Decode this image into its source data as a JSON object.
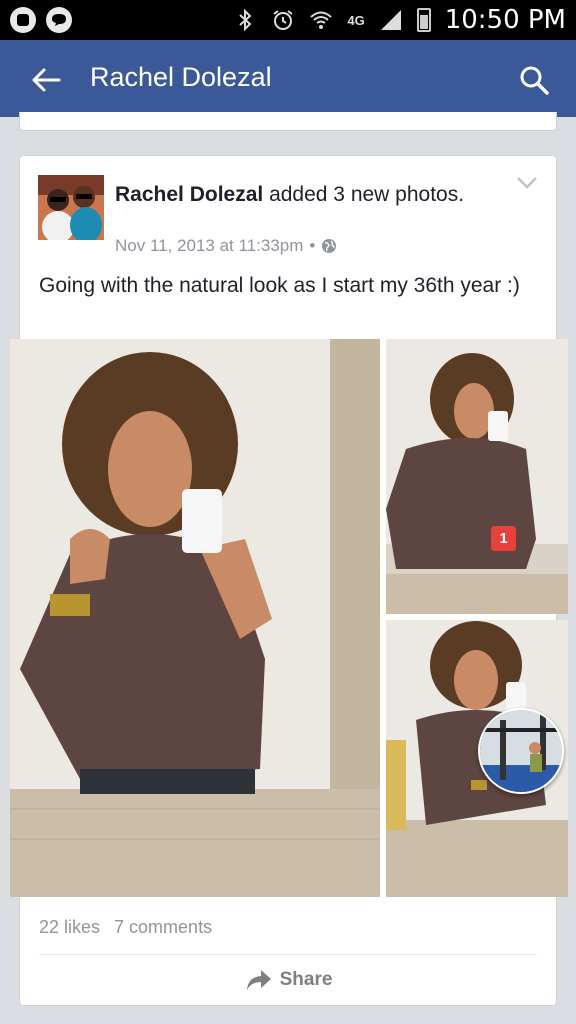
{
  "status_bar": {
    "time": "10:50 PM",
    "network": "4G",
    "icons": [
      "messenger-icon",
      "chat-icon",
      "bluetooth-icon",
      "alarm-icon",
      "wifi-icon",
      "signal-icon",
      "battery-icon"
    ]
  },
  "header": {
    "title": "Rachel Dolezal",
    "back_icon": "arrow-left-icon",
    "search_icon": "search-icon",
    "background": "#3b5998"
  },
  "post": {
    "author": "Rachel Dolezal",
    "action": " added 3 new photos.",
    "timestamp": "Nov 11, 2013 at 11:33pm",
    "separator": "•",
    "privacy_icon": "globe-icon",
    "text": "Going with the natural look as I start my 36th year :)",
    "likes": "22 likes",
    "comments": "7 comments",
    "share_label": "Share"
  },
  "chat_head": {
    "badge": "1",
    "badge_color": "#e8403a"
  }
}
